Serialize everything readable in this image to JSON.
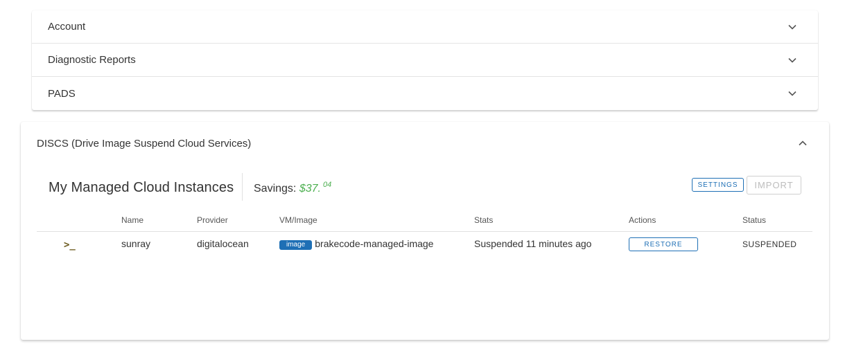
{
  "accordion": {
    "items": [
      {
        "label": "Account"
      },
      {
        "label": "Diagnostic Reports"
      },
      {
        "label": "PADS"
      }
    ]
  },
  "discs": {
    "title": "DISCS (Drive Image Suspend Cloud Services)",
    "heading": "My Managed Cloud Instances",
    "savings_label": "Savings:",
    "savings_amount": "$37.",
    "savings_cents": "04",
    "settings_label": "SETTINGS",
    "import_label": "IMPORT",
    "colors": {
      "accent": "#1e6fb5",
      "savings": "#4caf50"
    }
  },
  "table": {
    "headers": {
      "name": "Name",
      "provider": "Provider",
      "vm_image": "VM/Image",
      "stats": "Stats",
      "actions": "Actions",
      "status": "Status"
    },
    "rows": [
      {
        "icon": "terminal-icon",
        "terminal_glyph": ">_",
        "name": "sunray",
        "provider": "digitalocean",
        "badge": "image",
        "image": "brakecode-managed-image",
        "stats": "Suspended 11 minutes ago",
        "action": "RESTORE",
        "status": "SUSPENDED"
      }
    ]
  }
}
